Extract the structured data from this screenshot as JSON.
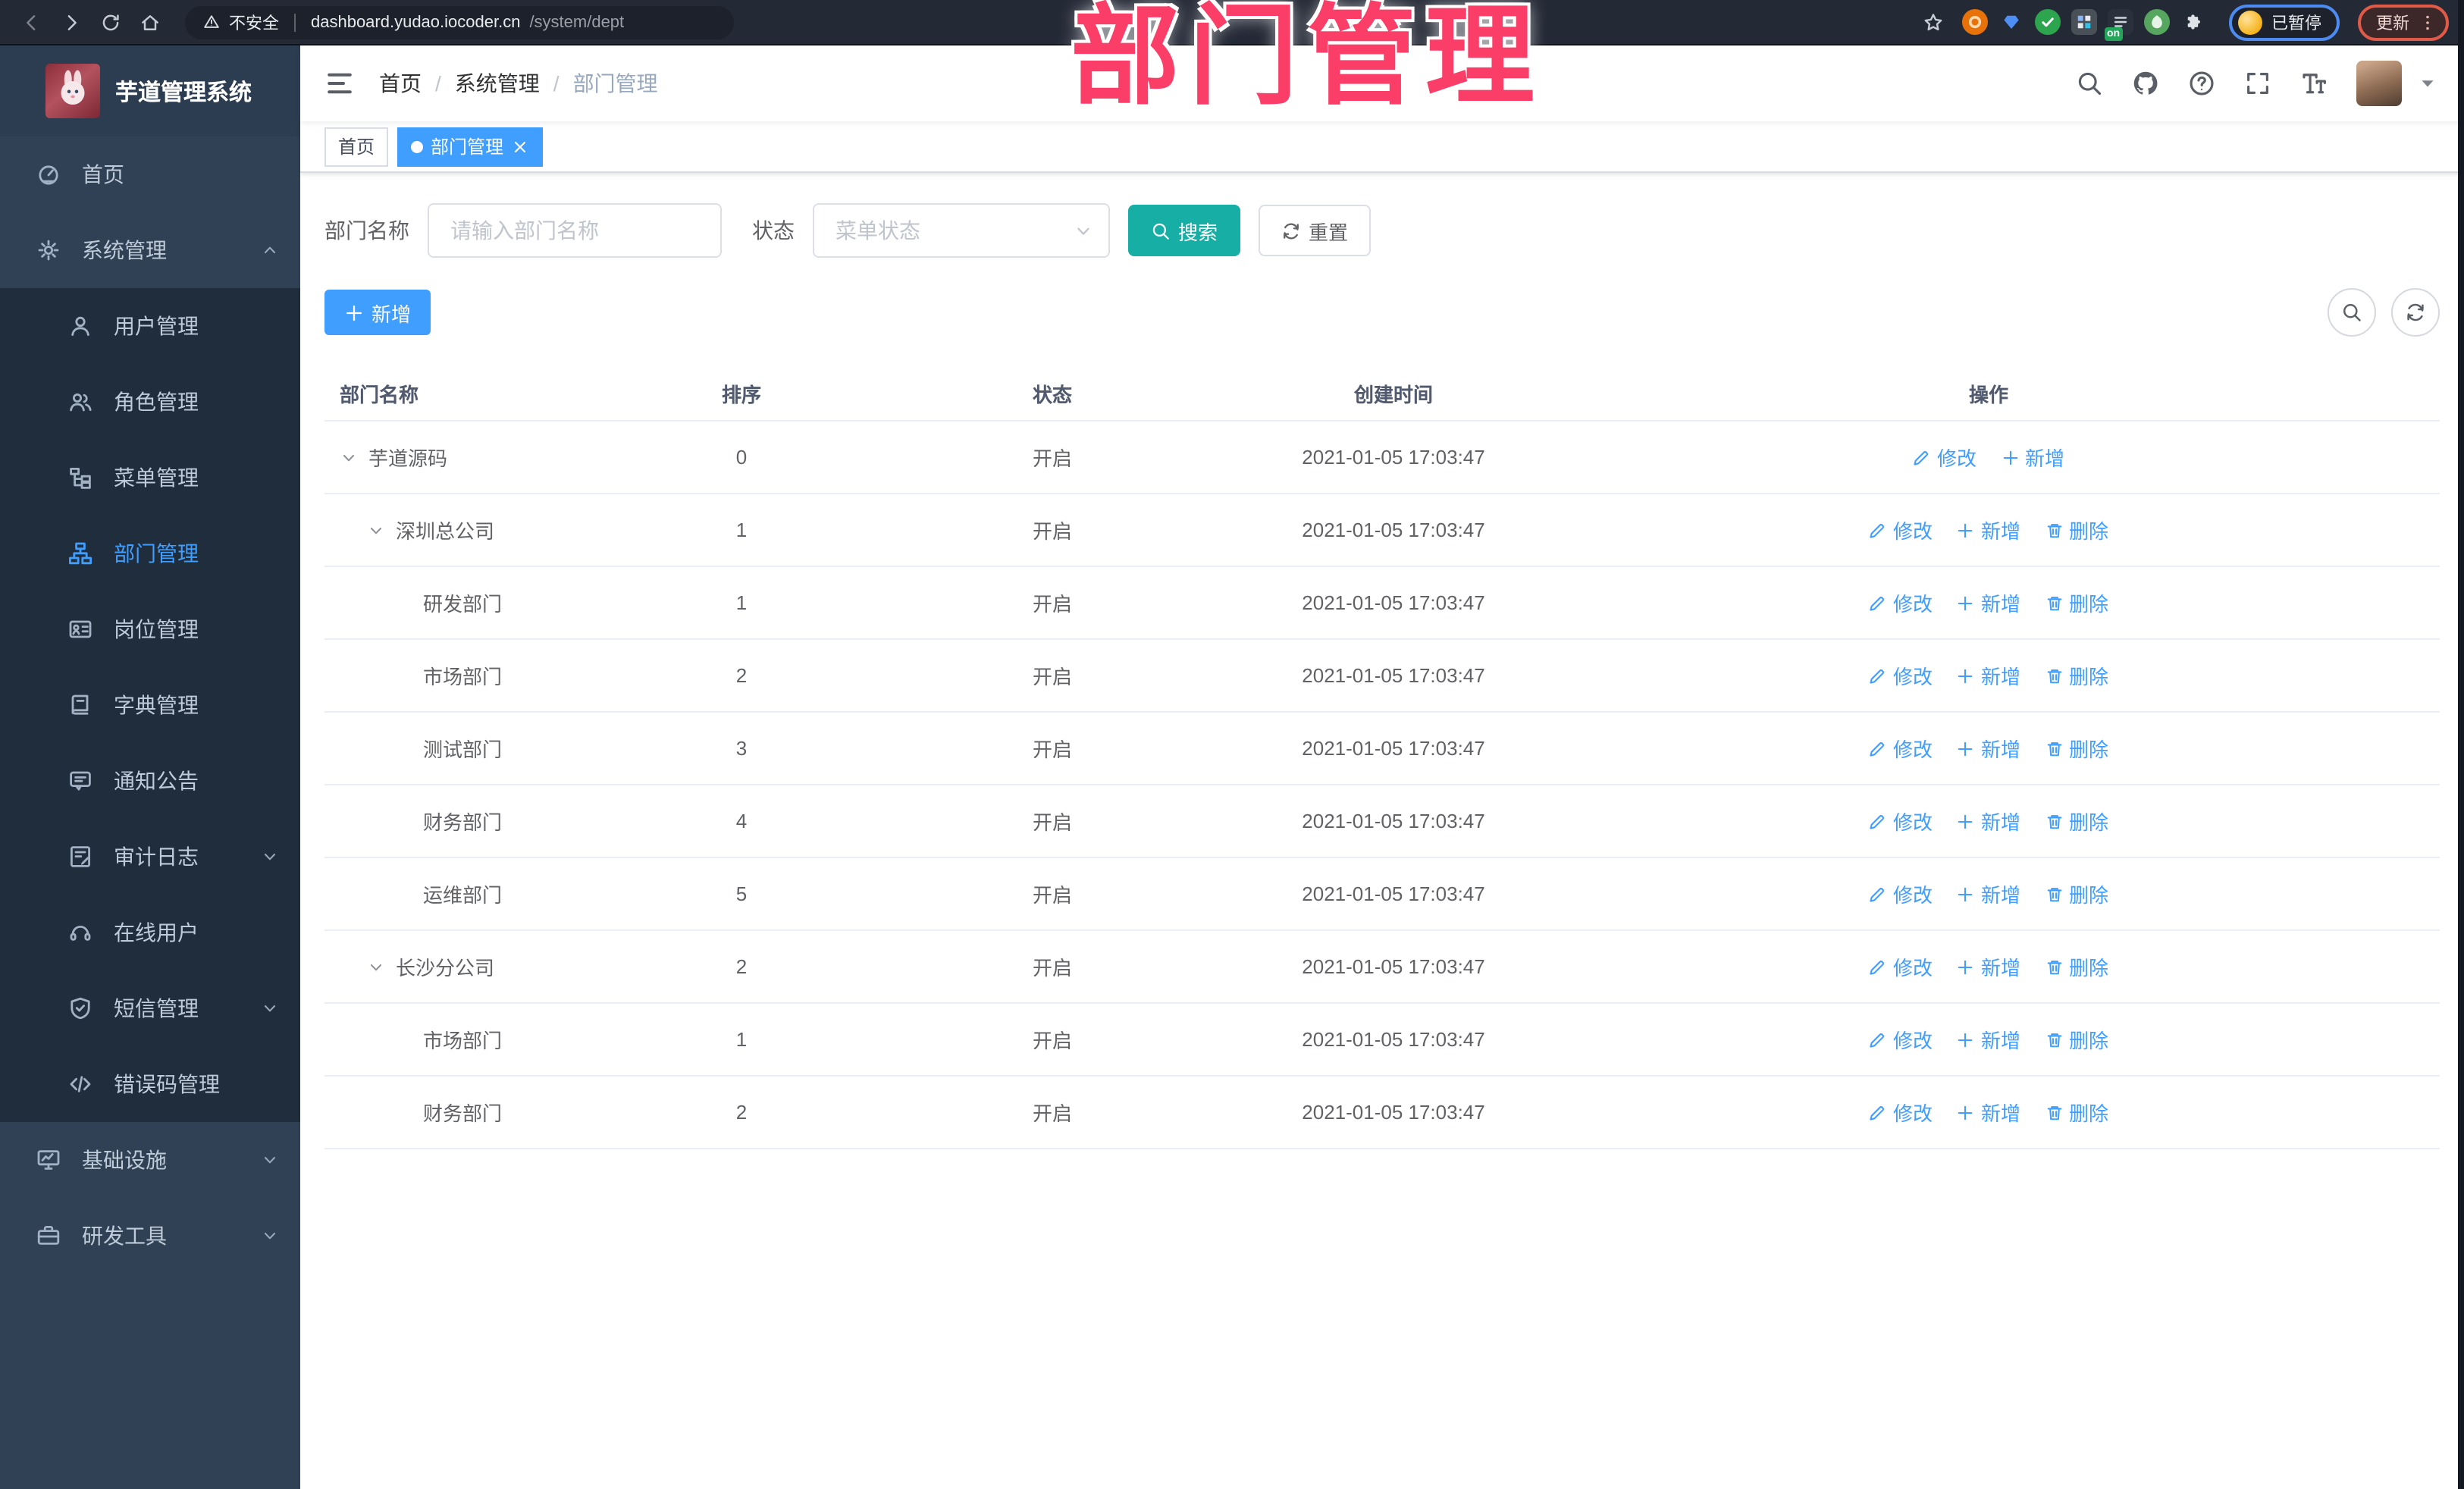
{
  "browser": {
    "security_label": "不安全",
    "url_host": "dashboard.yudao.iocoder.cn",
    "url_path": "/system/dept",
    "paused_label": "已暂停",
    "update_label": "更新",
    "extensions": [
      {
        "slug": "ext-orange-ring",
        "bg": "#e8710a",
        "shape": "ring"
      },
      {
        "slug": "ext-blue-gem",
        "bg": "transparent",
        "shape": "gem"
      },
      {
        "slug": "ext-green-check",
        "bg": "#2da44e",
        "shape": "check"
      },
      {
        "slug": "ext-grid",
        "bg": "#4a5057",
        "shape": "grid"
      },
      {
        "slug": "ext-list-on",
        "bg": "#2b313c",
        "shape": "list",
        "badge": "on"
      },
      {
        "slug": "ext-green-leaf",
        "bg": "#57a65f",
        "shape": "leaf"
      },
      {
        "slug": "ext-puzzle",
        "bg": "transparent",
        "shape": "puzzle"
      }
    ]
  },
  "annotation": {
    "text": "部门管理",
    "color": "#fb3e68"
  },
  "sidebar": {
    "title": "芋道管理系统",
    "menu": [
      {
        "slug": "home",
        "label": "首页",
        "icon": "dashboard"
      },
      {
        "slug": "system",
        "label": "系统管理",
        "icon": "gear",
        "expanded": true,
        "chevron": "up",
        "children": [
          {
            "slug": "user",
            "label": "用户管理",
            "icon": "user"
          },
          {
            "slug": "role",
            "label": "角色管理",
            "icon": "peoples"
          },
          {
            "slug": "menu",
            "label": "菜单管理",
            "icon": "treeTable"
          },
          {
            "slug": "dept",
            "label": "部门管理",
            "icon": "tree",
            "active": true
          },
          {
            "slug": "post",
            "label": "岗位管理",
            "icon": "postcard"
          },
          {
            "slug": "dict",
            "label": "字典管理",
            "icon": "dict"
          },
          {
            "slug": "notice",
            "label": "通知公告",
            "icon": "message"
          },
          {
            "slug": "audit-log",
            "label": "审计日志",
            "icon": "log",
            "chevron": "down"
          },
          {
            "slug": "online-user",
            "label": "在线用户",
            "icon": "online"
          },
          {
            "slug": "sms",
            "label": "短信管理",
            "icon": "sms",
            "chevron": "down"
          },
          {
            "slug": "error-code",
            "label": "错误码管理",
            "icon": "code"
          }
        ]
      },
      {
        "slug": "infra",
        "label": "基础设施",
        "icon": "monitor",
        "chevron": "down"
      },
      {
        "slug": "dev-tool",
        "label": "研发工具",
        "icon": "tool",
        "chevron": "down"
      }
    ]
  },
  "navbar": {
    "breadcrumb": [
      "首页",
      "系统管理",
      "部门管理"
    ]
  },
  "tabs": [
    {
      "label": "首页",
      "active": false
    },
    {
      "label": "部门管理",
      "active": true,
      "closable": true
    }
  ],
  "filters": {
    "dept_label": "部门名称",
    "dept_placeholder": "请输入部门名称",
    "status_label": "状态",
    "status_placeholder": "菜单状态",
    "search_label": "搜索",
    "reset_label": "重置"
  },
  "toolbar": {
    "add_label": "新增"
  },
  "table": {
    "columns": [
      "部门名称",
      "排序",
      "状态",
      "创建时间",
      "操作"
    ],
    "action_labels": {
      "edit": "修改",
      "add": "新增",
      "delete": "删除"
    },
    "rows": [
      {
        "name": "芋道源码",
        "level": 0,
        "expandable": true,
        "sort": "0",
        "status": "开启",
        "created": "2021-01-05 17:03:47",
        "actions": [
          "edit",
          "add"
        ]
      },
      {
        "name": "深圳总公司",
        "level": 1,
        "expandable": true,
        "sort": "1",
        "status": "开启",
        "created": "2021-01-05 17:03:47",
        "actions": [
          "edit",
          "add",
          "delete"
        ]
      },
      {
        "name": "研发部门",
        "level": 2,
        "expandable": false,
        "sort": "1",
        "status": "开启",
        "created": "2021-01-05 17:03:47",
        "actions": [
          "edit",
          "add",
          "delete"
        ]
      },
      {
        "name": "市场部门",
        "level": 2,
        "expandable": false,
        "sort": "2",
        "status": "开启",
        "created": "2021-01-05 17:03:47",
        "actions": [
          "edit",
          "add",
          "delete"
        ]
      },
      {
        "name": "测试部门",
        "level": 2,
        "expandable": false,
        "sort": "3",
        "status": "开启",
        "created": "2021-01-05 17:03:47",
        "actions": [
          "edit",
          "add",
          "delete"
        ]
      },
      {
        "name": "财务部门",
        "level": 2,
        "expandable": false,
        "sort": "4",
        "status": "开启",
        "created": "2021-01-05 17:03:47",
        "actions": [
          "edit",
          "add",
          "delete"
        ]
      },
      {
        "name": "运维部门",
        "level": 2,
        "expandable": false,
        "sort": "5",
        "status": "开启",
        "created": "2021-01-05 17:03:47",
        "actions": [
          "edit",
          "add",
          "delete"
        ]
      },
      {
        "name": "长沙分公司",
        "level": 1,
        "expandable": true,
        "sort": "2",
        "status": "开启",
        "created": "2021-01-05 17:03:47",
        "actions": [
          "edit",
          "add",
          "delete"
        ]
      },
      {
        "name": "市场部门",
        "level": 2,
        "expandable": false,
        "sort": "1",
        "status": "开启",
        "created": "2021-01-05 17:03:47",
        "actions": [
          "edit",
          "add",
          "delete"
        ]
      },
      {
        "name": "财务部门",
        "level": 2,
        "expandable": false,
        "sort": "2",
        "status": "开启",
        "created": "2021-01-05 17:03:47",
        "actions": [
          "edit",
          "add",
          "delete"
        ]
      }
    ]
  },
  "colors": {
    "accent_blue": "#409eff",
    "search_teal": "#17aea5",
    "sidebar_bg": "#304156",
    "submenu_bg": "#1f2d3d",
    "annotation_pink": "#fb3e68",
    "browser_bar": "#242936"
  }
}
